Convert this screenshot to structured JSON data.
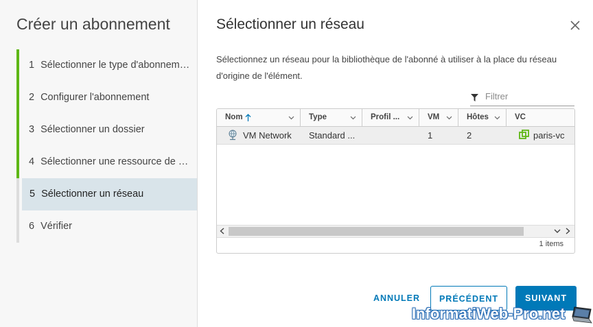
{
  "sidebar": {
    "title": "Créer un abonnement",
    "steps": [
      {
        "num": "1",
        "label": "Sélectionner le type d'abonnem…",
        "state": "done"
      },
      {
        "num": "2",
        "label": "Configurer l'abonnement",
        "state": "done"
      },
      {
        "num": "3",
        "label": "Sélectionner un dossier",
        "state": "done"
      },
      {
        "num": "4",
        "label": "Sélectionner une ressource de …",
        "state": "done"
      },
      {
        "num": "5",
        "label": "Sélectionner un réseau",
        "state": "active"
      },
      {
        "num": "6",
        "label": "Vérifier",
        "state": "pending"
      }
    ]
  },
  "dialog": {
    "title": "Sélectionner un réseau",
    "description": "Sélectionnez un réseau pour la bibliothèque de l'abonné à utiliser à la place du réseau d'origine de l'élément.",
    "filter_placeholder": "Filtrer"
  },
  "grid": {
    "columns": [
      {
        "label": "Nom",
        "sorted": "asc"
      },
      {
        "label": "Type"
      },
      {
        "label": "Profil ..."
      },
      {
        "label": "VM"
      },
      {
        "label": "Hôtes"
      },
      {
        "label": "VC"
      }
    ],
    "rows": [
      {
        "name": "VM Network",
        "type": "Standard ...",
        "profile": "",
        "vm": "1",
        "hosts": "2",
        "vc": "paris-vc"
      }
    ],
    "footer": "1 items"
  },
  "buttons": {
    "cancel": "ANNULER",
    "previous": "PRÉCÉDENT",
    "next": "SUIVANT"
  },
  "watermark": "InformatiWeb-Pro.net",
  "colors": {
    "accent": "#0079b8",
    "step_done": "#5eb715",
    "active_step_bg": "#d9e4ea"
  }
}
